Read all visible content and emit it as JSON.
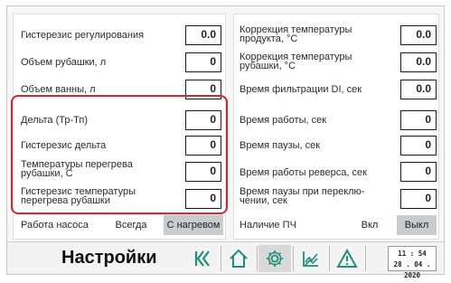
{
  "left_params": [
    {
      "label": "Гистерезис регулирования",
      "value": "0.0"
    },
    {
      "label": "Объем рубашки, л",
      "value": "0"
    },
    {
      "label": "Объем ванны, л",
      "value": "0"
    },
    {
      "label": "Дельта (Тр-Тп)",
      "value": "0"
    },
    {
      "label": "Гистерезис дельта",
      "value": "0"
    },
    {
      "label": "Температуры перегрева рубашки, С",
      "value": "0"
    },
    {
      "label": "Гистерезис температуры перегрева рубашки",
      "value": "0"
    }
  ],
  "right_params": [
    {
      "label": "Коррекция температуры продукта, °С",
      "value": "0.0"
    },
    {
      "label": "Коррекция температуры рубашки, °С",
      "value": "0.0"
    },
    {
      "label": "Время фильтрации DI, сек",
      "value": "0.0"
    },
    {
      "label": "Время работы, сек",
      "value": "0"
    },
    {
      "label": "Время паузы, сек",
      "value": "0"
    },
    {
      "label": "Время работы реверса, сек",
      "value": "0"
    },
    {
      "label": "Время паузы при переклю-чении, сек",
      "value": "0"
    }
  ],
  "pump": {
    "label": "Работа насоса",
    "option_always": "Всегда",
    "option_heating": "С нагревом",
    "selected": "С нагревом"
  },
  "fc": {
    "label": "Наличие ПЧ",
    "option_on": "Вкл",
    "option_off": "Выкл",
    "selected": "Выкл"
  },
  "footer": {
    "title": "Настройки",
    "time": "11 : 54",
    "date": "28 . 04 . 2020",
    "nav_icons": [
      "chevrons-left-icon",
      "home-icon",
      "gear-icon",
      "chart-icon",
      "warning-icon"
    ]
  },
  "colors": {
    "highlight": "#d6262f",
    "nav_icon": "#1e8f7a",
    "toggle_active": "#c9cbcf"
  }
}
